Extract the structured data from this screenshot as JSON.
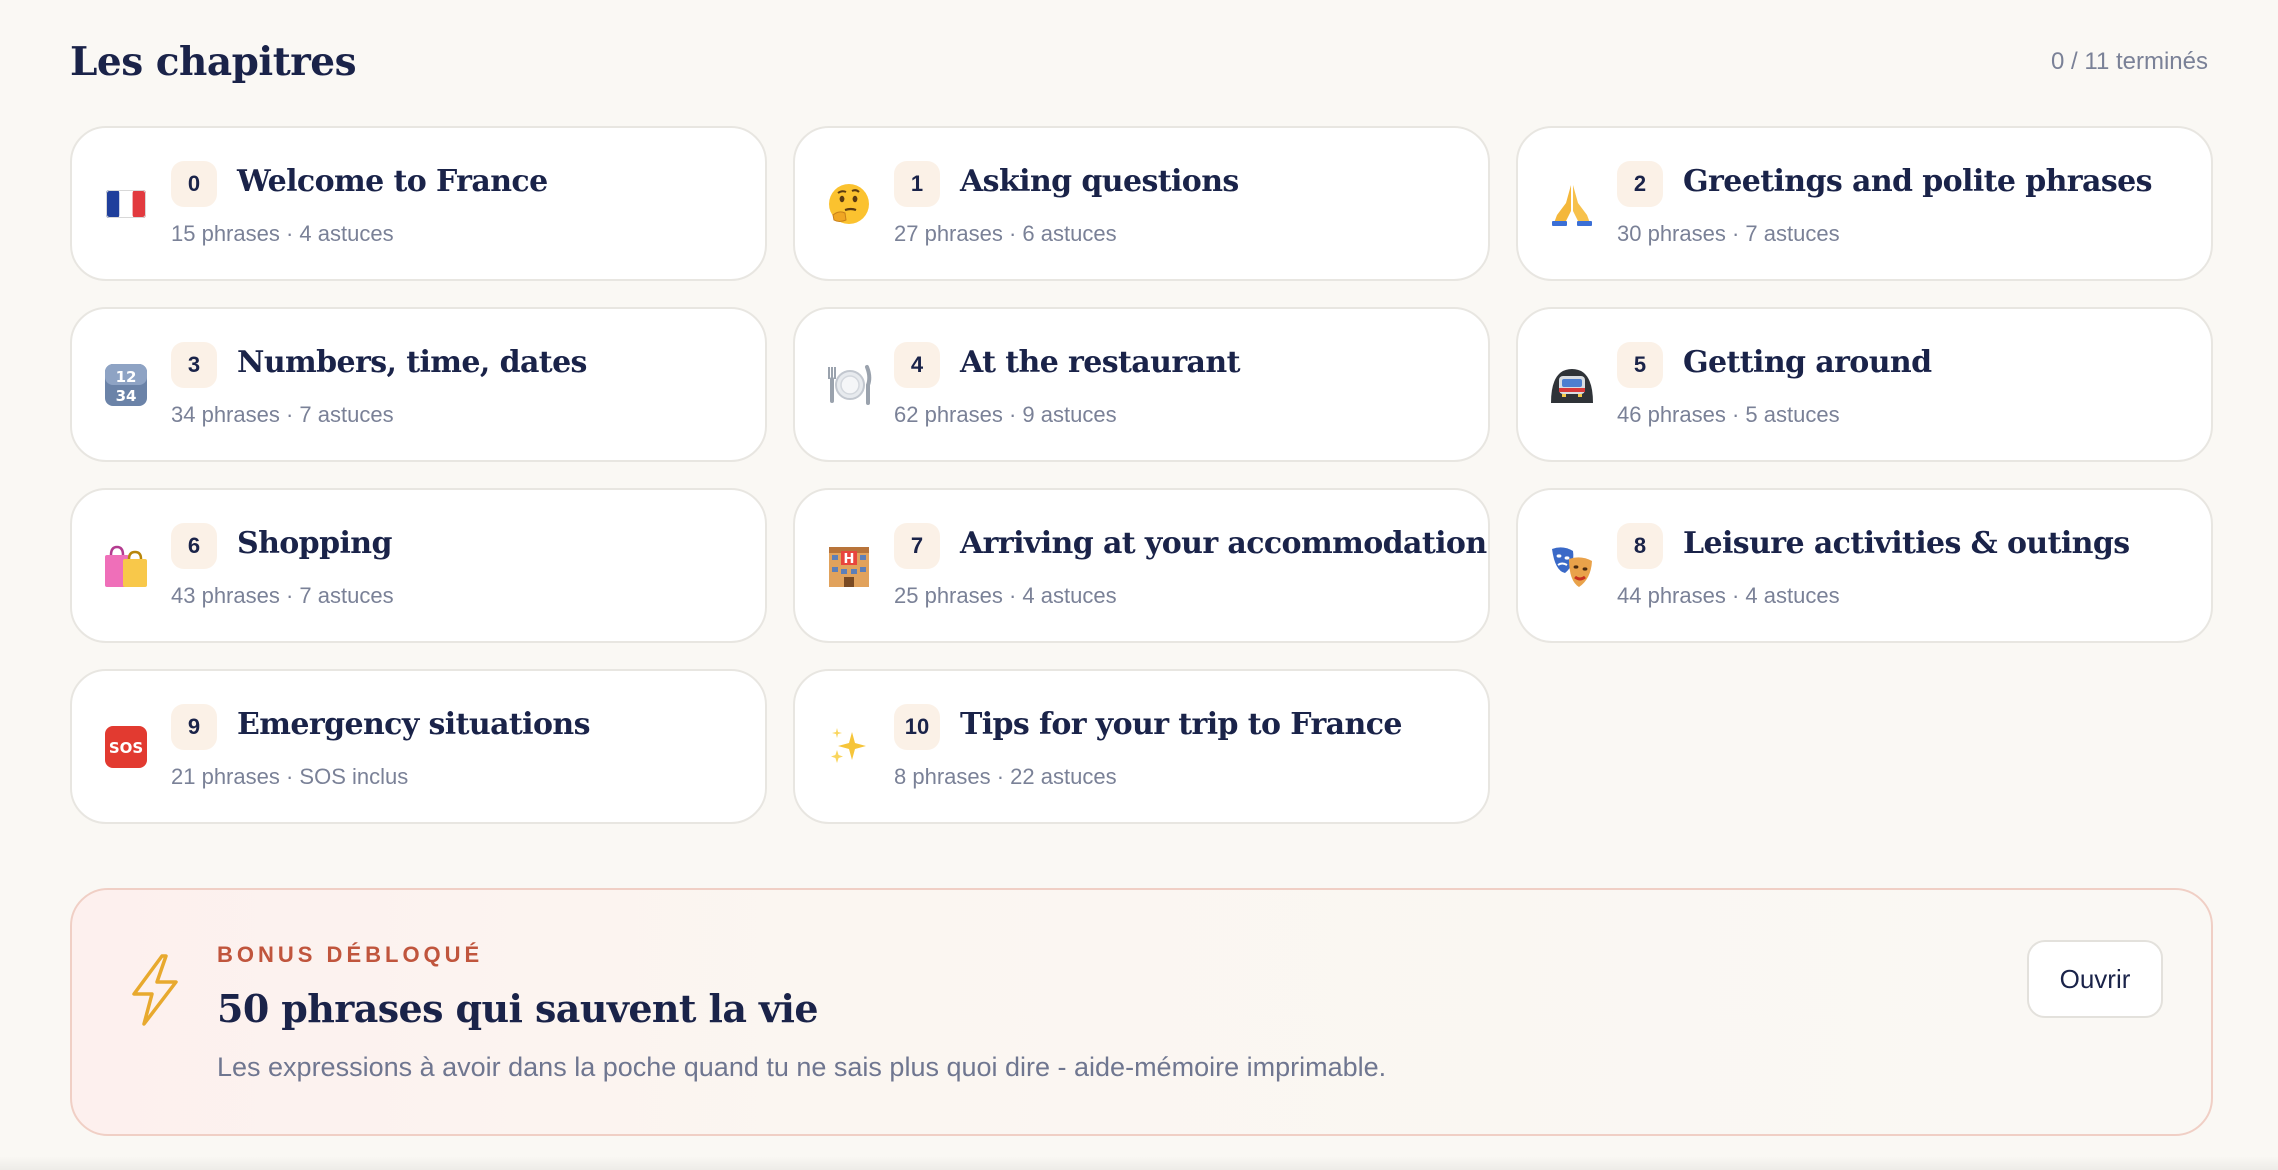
{
  "header": {
    "title": "Les chapitres",
    "progress": "0 / 11 terminés"
  },
  "chapters": [
    {
      "num": "0",
      "title": "Welcome to France",
      "meta": "15 phrases · 4 astuces",
      "icon": "france-flag-icon"
    },
    {
      "num": "1",
      "title": "Asking questions",
      "meta": "27 phrases · 6 astuces",
      "icon": "thinking-face-icon"
    },
    {
      "num": "2",
      "title": "Greetings and polite phrases",
      "meta": "30 phrases · 7 astuces",
      "icon": "folded-hands-icon"
    },
    {
      "num": "3",
      "title": "Numbers, time, dates",
      "meta": "34 phrases · 7 astuces",
      "icon": "numbers-icon"
    },
    {
      "num": "4",
      "title": "At the restaurant",
      "meta": "62 phrases · 9 astuces",
      "icon": "plate-cutlery-icon"
    },
    {
      "num": "5",
      "title": "Getting around",
      "meta": "46 phrases · 5 astuces",
      "icon": "metro-icon"
    },
    {
      "num": "6",
      "title": "Shopping",
      "meta": "43 phrases · 7 astuces",
      "icon": "shopping-bags-icon"
    },
    {
      "num": "7",
      "title": "Arriving at your accommodation",
      "meta": "25 phrases · 4 astuces",
      "icon": "hotel-icon"
    },
    {
      "num": "8",
      "title": "Leisure activities & outings",
      "meta": "44 phrases · 4 astuces",
      "icon": "theater-masks-icon"
    },
    {
      "num": "9",
      "title": "Emergency situations",
      "meta": "21 phrases · SOS inclus",
      "icon": "sos-icon"
    },
    {
      "num": "10",
      "title": "Tips for your trip to France",
      "meta": "8 phrases · 22 astuces",
      "icon": "sparkles-icon"
    }
  ],
  "bonus": {
    "label": "BONUS DÉBLOQUÉ",
    "title": "50 phrases qui sauvent la vie",
    "description": "Les expressions à avoir dans la poche quand tu ne sais plus quoi dire - aide-mémoire imprimable.",
    "button": "Ouvrir",
    "icon": "lightning-icon"
  },
  "sos_text": "SOS",
  "colors": {
    "background": "#faf8f4",
    "navy": "#1a2349",
    "muted": "#7a8197",
    "accent": "#c0553d",
    "badge_bg": "#fbf1e7"
  }
}
